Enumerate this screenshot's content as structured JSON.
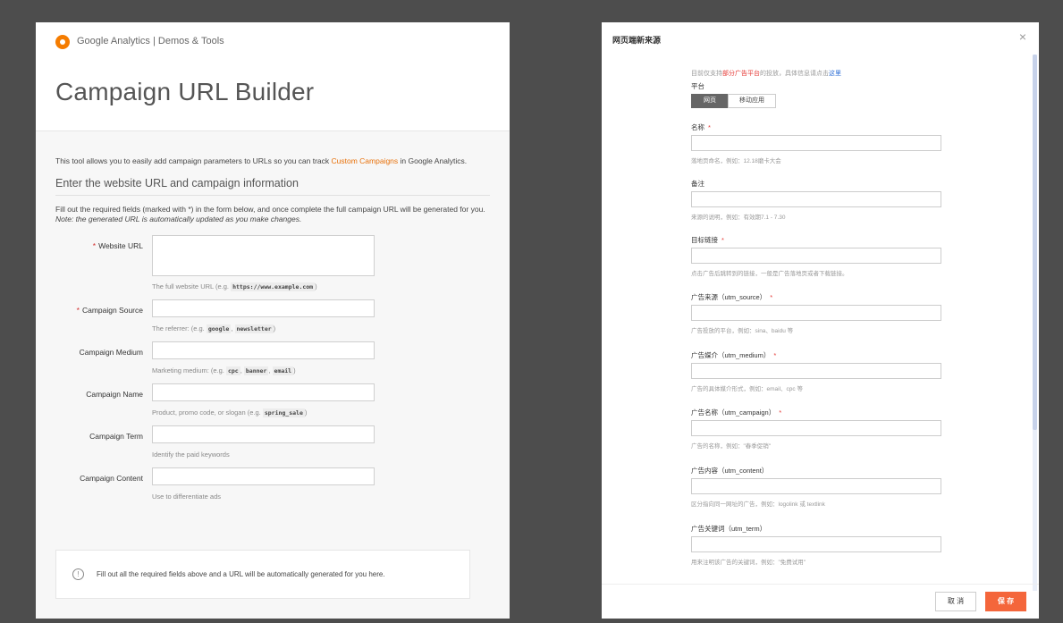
{
  "left": {
    "brand": "Google Analytics | Demos & Tools",
    "title": "Campaign URL Builder",
    "intro_before": "This tool allows you to easily add campaign parameters to URLs so you can track ",
    "intro_link": "Custom Campaigns",
    "intro_after": " in Google Analytics.",
    "section_title": "Enter the website URL and campaign information",
    "instructions_main": "Fill out the required fields (marked with *) in the form below, and once complete the full campaign URL will be generated for you. ",
    "instructions_note": "Note: the generated URL is automatically updated as you make changes.",
    "fields": [
      {
        "label": "Website URL",
        "required": "*",
        "help_before": "The full website URL (e.g. ",
        "codes": [
          "https://www.example.com"
        ],
        "help_after": ")"
      },
      {
        "label": "Campaign Source",
        "required": "*",
        "help_before": "The referrer: (e.g. ",
        "codes": [
          "google",
          "newsletter"
        ],
        "help_after": ")"
      },
      {
        "label": "Campaign Medium",
        "required": "",
        "help_before": "Marketing medium: (e.g. ",
        "codes": [
          "cpc",
          "banner",
          "email"
        ],
        "help_after": ")"
      },
      {
        "label": "Campaign Name",
        "required": "",
        "help_before": "Product, promo code, or slogan (e.g. ",
        "codes": [
          "spring_sale"
        ],
        "help_after": ")"
      },
      {
        "label": "Campaign Term",
        "required": "",
        "help_before": "Identify the paid keywords",
        "codes": [],
        "help_after": ""
      },
      {
        "label": "Campaign Content",
        "required": "",
        "help_before": "Use to differentiate ads",
        "codes": [],
        "help_after": ""
      }
    ],
    "code_separator": ", ",
    "output_info_icon": "!",
    "output_message": "Fill out all the required fields above and a URL will be automatically generated for you here."
  },
  "right": {
    "title": "网页端新来源",
    "close_glyph": "×",
    "notice_before": "目前仅支持",
    "notice_highlight": "部分广告平台",
    "notice_middle": "的投放，具体信息请点击",
    "notice_link": "这里",
    "platform_label": "平台",
    "platform_tabs": [
      "网页",
      "移动应用"
    ],
    "fields": [
      {
        "label": "名称",
        "required": "*",
        "help": "落地页命名，例如：12.18磨卡大会"
      },
      {
        "label": "备注",
        "required": "",
        "help": "来源的说明，例如：有效期7.1 - 7.30"
      },
      {
        "label": "目标链接",
        "required": "*",
        "help": "点击广告后跳转到的链接，一般是广告落地页或者下载链接。"
      },
      {
        "label": "广告来源（utm_source）",
        "required": "*",
        "help": "广告投放的平台，例如：sina、baidu 等"
      },
      {
        "label": "广告媒介（utm_medium）",
        "required": "*",
        "help": "广告的具体媒介形式，例如：email、cpc 等"
      },
      {
        "label": "广告名称（utm_campaign）",
        "required": "*",
        "help": "广告的名称，例如：\"春季促销\""
      },
      {
        "label": "广告内容（utm_content）",
        "required": "",
        "help": "区分指向同一网址的广告，例如：logolink 或 textlink"
      },
      {
        "label": "广告关键词（utm_term）",
        "required": "",
        "help": "用来注明该广告的关键词，例如：\"免费试用\""
      }
    ],
    "cancel_label": "取 消",
    "save_label": "保 存"
  }
}
